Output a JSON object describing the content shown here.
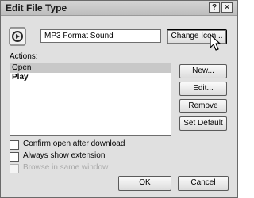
{
  "window": {
    "title": "Edit File Type",
    "help_glyph": "?",
    "close_glyph": "×"
  },
  "file_type": {
    "icon": "media-file-icon",
    "description": "MP3 Format Sound",
    "change_icon_label": "Change Icon..."
  },
  "actions": {
    "label": "Actions:",
    "items": [
      {
        "label": "Open",
        "selected": true,
        "default": false
      },
      {
        "label": "Play",
        "selected": false,
        "default": true
      }
    ],
    "buttons": {
      "new": "New...",
      "edit": "Edit...",
      "remove": "Remove",
      "set_default": "Set Default"
    }
  },
  "options": {
    "confirm_open": {
      "label": "Confirm open after download",
      "checked": false,
      "enabled": true
    },
    "always_show_ext": {
      "label": "Always show extension",
      "checked": false,
      "enabled": true
    },
    "browse_same_window": {
      "label": "Browse in same window",
      "checked": false,
      "enabled": false
    }
  },
  "footer": {
    "ok": "OK",
    "cancel": "Cancel"
  },
  "colors": {
    "dialog_bg": "#e0e0e0",
    "selection": "#c8c8c8",
    "disabled_text": "#a8a8a8"
  }
}
